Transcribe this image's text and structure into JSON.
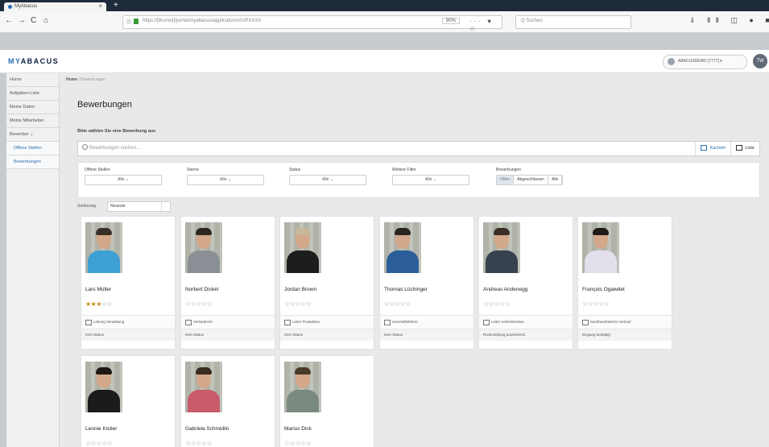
{
  "browser": {
    "tab_title": "MyAbacus",
    "tab_close": "×",
    "new_tab": "+",
    "back": "←",
    "forward": "→",
    "reload": "C",
    "home": "⌂",
    "url": "https://[blurred]/portal/myabacus/applicationsVUPXXXX",
    "zoom": "90%",
    "url_icons": "··· ♥ ☆",
    "search_placeholder": "Q Suchen",
    "toolbar_icons": "⇓ ⅡⅡ ◫ ● ■ ⋮"
  },
  "app": {
    "logo_prefix": "MY",
    "logo_rest": "ABACUS",
    "user_label": "ABACUSDEMO [7777] ▾",
    "user_initials": "TW"
  },
  "nav": {
    "items": [
      "Home",
      "Aufgaben-Liste",
      "Meine Daten",
      "Meine Mitarbeiter",
      "Bewerber ⌄"
    ],
    "sub_items": [
      "Offene Stellen",
      "Bewerbungen"
    ]
  },
  "breadcrumb": {
    "home": "Home",
    "rest": "/ Bewerbungen"
  },
  "page": {
    "title": "Bewerbungen",
    "instruction": "Bitte wählen Sie eine Bewerbung aus",
    "search_placeholder": "Bewerbungen suchen..."
  },
  "view_toggle": {
    "kacheln": "Kacheln",
    "liste": "Liste"
  },
  "filters": {
    "groups": [
      {
        "label": "Offene Stellen",
        "value": "Alle ⌄"
      },
      {
        "label": "Sterne",
        "value": "Alle ⌄"
      },
      {
        "label": "Status",
        "value": "Alle ⌄"
      },
      {
        "label": "Weitere Filter",
        "value": "Alle ⌄"
      }
    ],
    "bewerbungen_label": "Bewerbungen",
    "bewerbungen_options": [
      "Offen",
      "Abgeschlossen",
      "Alle"
    ]
  },
  "sort": {
    "label": "Sortierung",
    "value": "Neueste"
  },
  "candidates": [
    {
      "name": "Lars Müller",
      "rating": 3,
      "job": "Leitung Verwaltung",
      "status": "Kein Status",
      "shirt": "#3d9fd3",
      "hair": "#3a2e25"
    },
    {
      "name": "Norbert Dickel",
      "rating": 0,
      "job": "Verkäufer/in",
      "status": "Kein Status",
      "shirt": "#8a8f95",
      "hair": "#2e2620"
    },
    {
      "name": "Jordan Brown",
      "rating": 0,
      "job": "Leiter Produktion",
      "status": "Kein Status",
      "shirt": "#1d1d1d",
      "hair": "#c9b79a"
    },
    {
      "name": "Thomas Lüchinger",
      "rating": 0,
      "job": "Geschäftsführer",
      "status": "Kein Status",
      "shirt": "#2b5d9a",
      "hair": "#2a2420"
    },
    {
      "name": "Andreas Andenegg",
      "rating": 0,
      "job": "Leiter Administration",
      "status": "Rückmeldung ausstehend",
      "shirt": "#37424e",
      "hair": "#3a2e25"
    },
    {
      "name": "François Ogawdet",
      "rating": 0,
      "job": "Sachbearbeiterin Verkauf",
      "status": "Eingang bestätigt",
      "shirt": "#e3e0ec",
      "hair": "#1f1a17"
    },
    {
      "name": "Leonie Kistler",
      "rating": 0,
      "job": "",
      "status": "",
      "shirt": "#1b1b1b",
      "hair": "#1e1814"
    },
    {
      "name": "Gabriela Schmidlin",
      "rating": 0,
      "job": "",
      "status": "",
      "shirt": "#c95a6a",
      "hair": "#3b2a20"
    },
    {
      "name": "Marius Dick",
      "rating": 0,
      "job": "",
      "status": "",
      "shirt": "#7b8a80",
      "hair": "#4a3a2a"
    }
  ]
}
